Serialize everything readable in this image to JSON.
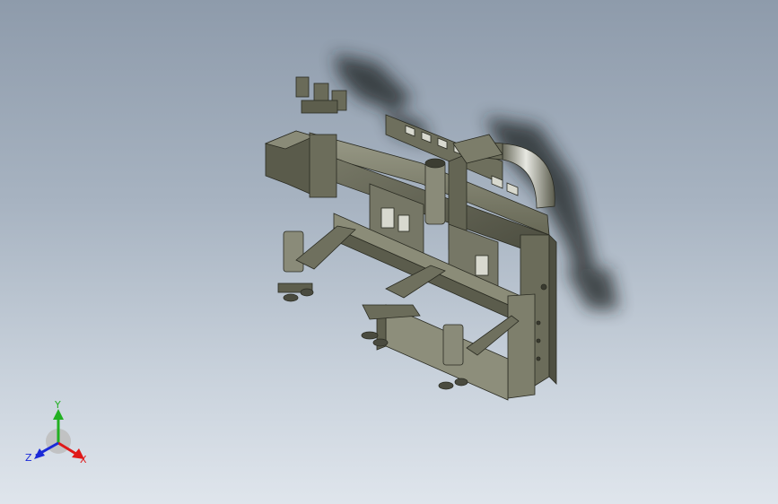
{
  "viewport": {
    "background_top": "#8e9bab",
    "background_bottom": "#dfe5ec",
    "model_color": "#5e5f4f",
    "model_shadow": "#1f2424"
  },
  "triad": {
    "x_label": "X",
    "y_label": "Y",
    "z_label": "Z",
    "x_color": "#e01818",
    "y_color": "#22b022",
    "z_color": "#1a2ad8"
  }
}
